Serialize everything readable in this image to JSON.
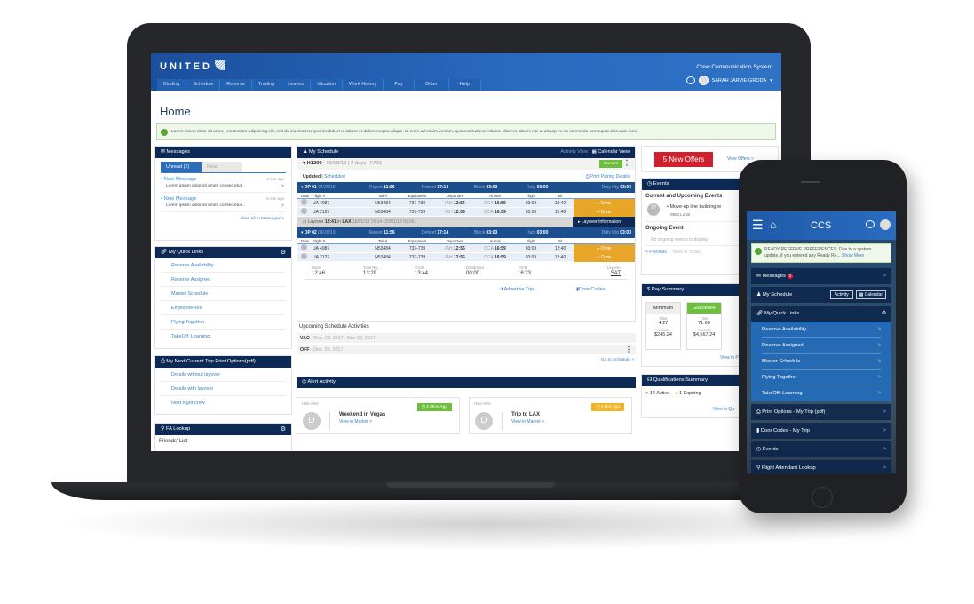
{
  "desktop": {
    "brand": "UNITED",
    "system_name": "Crew Communication System",
    "user_name": "SARAH JARVIE-GRODA",
    "nav": [
      "Bidding",
      "Schedule",
      "Reserve",
      "Trading",
      "Leaves",
      "Vacation",
      "Work History",
      "Pay",
      "Other",
      "Help"
    ],
    "page_title": "Home",
    "alert_text": "Lorem ipsum dolor sit amet, consectetur adipiscing elit, sed do eiusmod tempor incididunt ut labore et dolore magna aliqua. Ut enim ad minim veniam, quis nostrud exercitation ullamco laboris nisi ut aliquip ex ea commodo consequat duis aute irure.",
    "messages": {
      "title": "Messages",
      "tabs": [
        "Unread (2)",
        "Read"
      ],
      "items": [
        {
          "title": "New Message",
          "time": "3 min ago",
          "body": "Lorem ipsum dolor sit amet, consectetur..."
        },
        {
          "title": "New Message",
          "time": "5 min ago",
          "body": "Lorem ipsum dolor sit amet, consectetur..."
        }
      ],
      "view_all": "View All in Messages >"
    },
    "quick_links": {
      "title": "My Quick Links",
      "items": [
        "Reserve Availability",
        "Reserve Assigned",
        "Master Schedule",
        "EmployeeRes",
        "Flying Together",
        "TakeOff: Learning"
      ]
    },
    "print_options": {
      "title": "My Next/Current Trip Print Options(pdf)",
      "items": [
        "Details without layover",
        "Details with layover",
        "Next flight crew"
      ]
    },
    "fa_lookup": {
      "title": "FA Lookup",
      "friends": "Friends' List"
    },
    "schedule": {
      "title": "My Schedule",
      "activity_view": "Activity View",
      "calendar_view": "Calendar View",
      "pairing": "H1200",
      "pairing_info": " - 09/08/19 | 2 days | FA01",
      "status": "Current",
      "updated": "Updated",
      "scheduled": "Scheduled",
      "print_pairing": "Print Pairing Details",
      "headers": [
        "Date",
        "Flight #",
        "Tail #",
        "Equipment",
        "Departure",
        "Arrival",
        "Flight",
        "Sit"
      ],
      "duty_periods": [
        {
          "label": "DP 01",
          "date": "04/25/19",
          "report": "11:56",
          "debrief": "17:14",
          "block": "03:03",
          "duty": "03:00",
          "duty_rig": "03:03",
          "flights": [
            {
              "flight": "UA 4987",
              "tail": "N53484",
              "equip": "737-739",
              "dep_code": "IAH",
              "dep": "12:56",
              "arr_code": "DCA",
              "arr": "16:59",
              "flight_time": "03:03",
              "sit": "12:40",
              "crew": "Crew"
            },
            {
              "flight": "UA 2127",
              "tail": "N53484",
              "equip": "737-739",
              "dep_code": "IAH",
              "dep": "12:56",
              "arr_code": "DCA",
              "arr": "16:59",
              "flight_time": "03:03",
              "sit": "12:40",
              "crew": "Crew"
            }
          ]
        },
        {
          "label": "DP 02",
          "date": "04/26/19",
          "report": "11:56",
          "debrief": "17:14",
          "block": "03:03",
          "duty": "03:00",
          "duty_rig": "03:03",
          "flights": [
            {
              "flight": "UA 4987",
              "tail": "N53484",
              "equip": "737-739",
              "dep_code": "IAH",
              "dep": "12:56",
              "arr_code": "DCA",
              "arr": "16:59",
              "flight_time": "03:03",
              "sit": "12:40",
              "crew": "Crew"
            },
            {
              "flight": "UA 2127",
              "tail": "N53484",
              "equip": "737-739",
              "dep_code": "IAH",
              "dep": "12:56",
              "arr_code": "DCA",
              "arr": "16:59",
              "flight_time": "03:03",
              "sit": "12:40",
              "crew": "Crew"
            }
          ]
        }
      ],
      "labels": {
        "report": "Report",
        "debrief": "Debrief",
        "block": "Block",
        "duty": "Duty",
        "duty_rig": "Duty Rig"
      },
      "layover": {
        "label": "Layover",
        "time": "15:41",
        "in": "in",
        "city": "LAX",
        "range": "18/01/18 15:14- 20/01/18 09:06",
        "button": "Layover Information"
      },
      "totals": [
        {
          "label": "Block",
          "value": "12:46"
        },
        {
          "label": "Total Rig",
          "value": "13:29"
        },
        {
          "label": "Credit",
          "value": "13:44"
        },
        {
          "label": "Deadhead",
          "value": "00:00"
        },
        {
          "label": "TAFB",
          "value": "16:23"
        },
        {
          "label": "Layover",
          "value": "SAT"
        }
      ],
      "advertise": "Advertise Trip",
      "door_codes": "Door Codes"
    },
    "upcoming": {
      "title": "Upcoming Schedule Activities",
      "items": [
        {
          "code": "VAC",
          "dates": " - Dec. 20, 2017 - Dec 22, 2017"
        },
        {
          "code": "OFF",
          "dates": " - Dec. 20, 2017"
        }
      ],
      "go_to": "Go to Schedule >"
    },
    "alerts": {
      "title": "Alert Activity",
      "items": [
        {
          "hide": "Hide Alert",
          "badge": "2 Mins Ago",
          "badge_color": "#6cbf3c",
          "initial": "D",
          "title": "Weekend in Vegas",
          "link": "View in Market >"
        },
        {
          "hide": "Hide Alert",
          "badge": "4 Hrs Ago",
          "badge_color": "#f0b429",
          "initial": "D",
          "title": "Trip to LAX",
          "link": "View in Market >"
        }
      ]
    },
    "offers": {
      "button": "5 New Offers",
      "link": "View Offers >"
    },
    "events": {
      "title": "Events",
      "current_heading": "Current and Upcoming Events",
      "event_day": "17",
      "event_month": "MAY",
      "event_title": "Move-up line building w",
      "event_time": "0800 Local",
      "ongoing_heading": "Ongoing Event",
      "ongoing_empty": "No ongoing events to display",
      "previous": "< Previous",
      "back_today": "Back to Today"
    },
    "pay": {
      "title": "Pay Summary",
      "columns": [
        {
          "name": "Minimum",
          "time_label": "Time",
          "time": "4:27",
          "amount_label": "Amount",
          "amount": "$245.24"
        },
        {
          "name": "Guarantee",
          "time_label": "Time",
          "time": "71:00",
          "amount_label": "Amount",
          "amount": "$4,567.24"
        }
      ],
      "view": "View in P"
    },
    "quals": {
      "title": "Qualifications Summary",
      "active": "14 Active",
      "expiring": "1 Expiring",
      "view": "View in Qu"
    }
  },
  "mobile": {
    "title": "CCS",
    "alert": "READY RESERVE PREFERENCES: Due to a system update, if you entered any Ready Re...",
    "show_more": "Show More",
    "messages": "Messages",
    "message_count": "5",
    "schedule": "My Schedule",
    "activity_btn": "Activity",
    "calendar_btn": "Calendar",
    "quick_links_title": "My Quick Links",
    "quick_links": [
      "Reserve Availability",
      "Reserve Assigned",
      "Master Schedule",
      "Flying Together",
      "TakeOff: Learning"
    ],
    "menu": [
      "Print Options - My Trip (pdf)",
      "Door Codes - My Trip",
      "Events",
      "Flight Attendant Lookup"
    ]
  },
  "colors": {
    "brand_blue": "#1b4f9c",
    "navy": "#0c2a55",
    "crew_orange": "#e8a628",
    "offer_red": "#d0202e",
    "success_green": "#6cbf3c"
  }
}
